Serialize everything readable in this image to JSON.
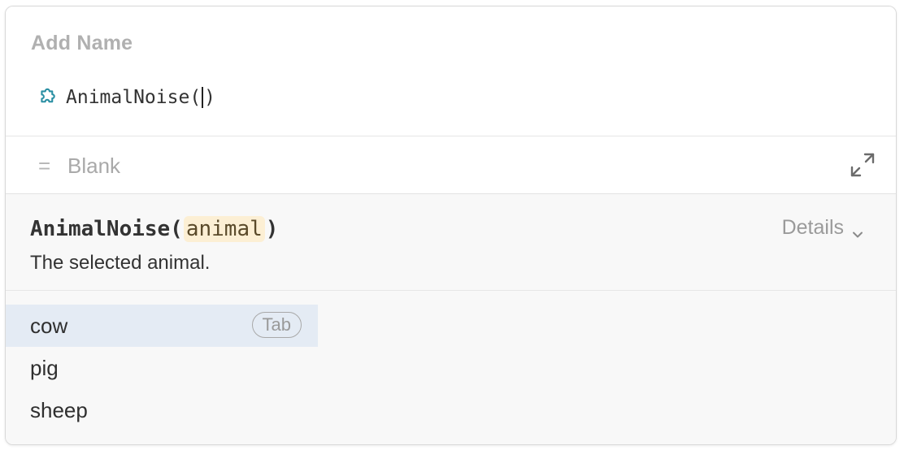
{
  "name_field": {
    "placeholder": "Add Name"
  },
  "formula": {
    "icon": "puzzle-icon",
    "prefix": "AnimalNoise(",
    "suffix": ")"
  },
  "result": {
    "equals_symbol": "=",
    "value": "Blank",
    "expand_icon": "expand-icon"
  },
  "help": {
    "function_name": "AnimalNoise(",
    "param": "animal",
    "close": ")",
    "description": "The selected animal.",
    "details_label": "Details"
  },
  "suggestions": {
    "items": [
      {
        "label": "cow",
        "selected": true,
        "hint": "Tab"
      },
      {
        "label": "pig"
      },
      {
        "label": "sheep"
      }
    ]
  },
  "colors": {
    "accent_teal": "#2a8fa3",
    "selected_bg": "#e4ebf4",
    "param_bg": "#fcefd4"
  }
}
